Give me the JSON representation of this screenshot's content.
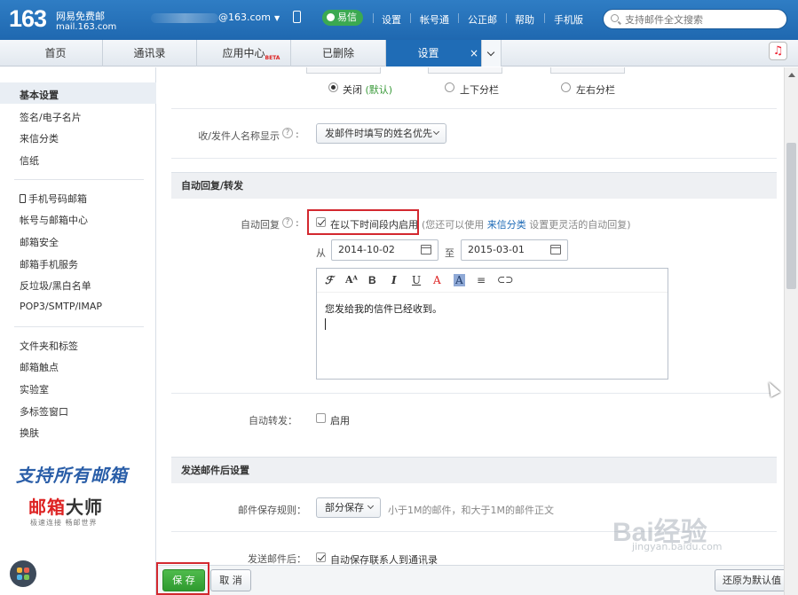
{
  "header": {
    "logo_number": "163",
    "logo_name": "网易免费邮",
    "logo_domain": "mail.163.com",
    "account": "@163.com",
    "yixin_label": "易信",
    "links": [
      "设置",
      "帐号通",
      "公正邮",
      "帮助",
      "手机版"
    ],
    "search_placeholder": "支持邮件全文搜索"
  },
  "tabs": [
    {
      "label": "首页"
    },
    {
      "label": "通讯录"
    },
    {
      "label": "应用中心",
      "badge": "BETA"
    },
    {
      "label": "已删除"
    },
    {
      "label": "设置",
      "close": "×"
    }
  ],
  "sidebar": {
    "groups": [
      [
        "基本设置",
        "签名/电子名片",
        "来信分类",
        "信纸"
      ],
      [
        "手机号码邮箱",
        "帐号与邮箱中心",
        "邮箱安全",
        "邮箱手机服务",
        "反垃圾/黑白名单",
        "POP3/SMTP/IMAP"
      ],
      [
        "文件夹和标签",
        "邮箱触点",
        "实验室",
        "多标签窗口",
        "换肤"
      ]
    ],
    "promo_line1": "支持所有邮箱",
    "promo_line2a": "邮箱",
    "promo_line2b": "大师",
    "promo_line3": "极速连接  畅邮世界"
  },
  "settings": {
    "layout_options": [
      {
        "label": "关闭",
        "extra": "(默认)",
        "selected": true
      },
      {
        "label": "上下分栏",
        "selected": false
      },
      {
        "label": "左右分栏",
        "selected": false
      }
    ],
    "sender_name_label": "收/发件人名称显示",
    "sender_name_value": "发邮件时填写的姓名优先",
    "auto_section_title": "自动回复/转发",
    "auto_reply_label": "自动回复",
    "auto_reply_checkbox": "在以下时间段内启用",
    "auto_reply_note_prefix": "(您还可以使用",
    "auto_reply_note_link": "来信分类",
    "auto_reply_note_suffix": "设置更灵活的自动回复)",
    "from_label": "从",
    "from_date": "2014-10-02",
    "to_label": "至",
    "to_date": "2015-03-01",
    "editor_text": "您发给我的信件已经收到。",
    "auto_forward_label": "自动转发",
    "auto_forward_checkbox": "启用",
    "after_send_title": "发送邮件后设置",
    "save_rule_label": "邮件保存规则",
    "save_rule_value": "部分保存",
    "save_rule_note": "小于1M的邮件，和大于1M的邮件正文",
    "after_send_label": "发送邮件后",
    "after_send_checkbox": "自动保存联系人到通讯录"
  },
  "buttons": {
    "save": "保 存",
    "cancel": "取 消",
    "restore": "还原为默认值"
  },
  "watermark": {
    "brand": "Bai经验",
    "url": "jingyan.baidu.com"
  },
  "colors": {
    "header_blue": "#1f68b0",
    "active_tab": "#1f6cb6",
    "save_green": "#2f9a2f",
    "highlight_red": "#d3282f",
    "link_blue": "#1d6ab6"
  }
}
